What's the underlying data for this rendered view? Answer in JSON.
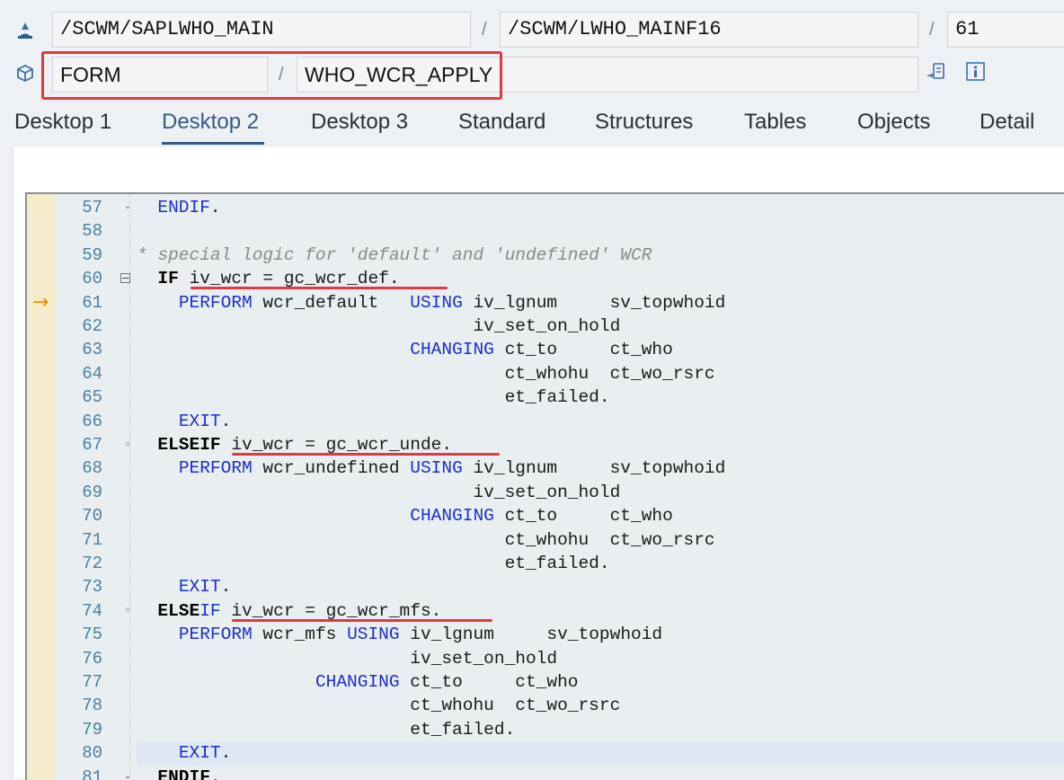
{
  "header": {
    "program": "/SCWM/SAPLWHO_MAIN",
    "include": "/SCWM/LWHO_MAINF16",
    "line": "61",
    "type": "FORM",
    "name": "WHO_WCR_APPLY",
    "sep": "/",
    "icons": [
      "program-icon",
      "cube-icon",
      "list-nav-icon",
      "info-icon"
    ]
  },
  "tabs": [
    {
      "label": "Desktop 1"
    },
    {
      "label": "Desktop 2"
    },
    {
      "label": "Desktop 3"
    },
    {
      "label": "Standard"
    },
    {
      "label": "Structures"
    },
    {
      "label": "Tables"
    },
    {
      "label": "Objects"
    },
    {
      "label": "Detail"
    }
  ],
  "active_tab": "Desktop 2",
  "current_line_marker": "→",
  "code_lines": [
    {
      "n": "57",
      "segs": [
        {
          "t": "  ",
          "c": ""
        },
        {
          "t": "ENDIF",
          "c": "kw"
        },
        {
          "t": ".",
          "c": ""
        }
      ]
    },
    {
      "n": "58",
      "segs": []
    },
    {
      "n": "59",
      "segs": [
        {
          "t": "* special logic for 'default' and 'undefined' WCR",
          "c": "cmt"
        }
      ]
    },
    {
      "n": "60",
      "segs": [
        {
          "t": "  ",
          "c": ""
        },
        {
          "t": "IF",
          "c": "kwb"
        },
        {
          "t": " iv_wcr = gc_wcr_def.",
          "c": ""
        }
      ]
    },
    {
      "n": "61",
      "segs": [
        {
          "t": "    ",
          "c": ""
        },
        {
          "t": "PERFORM",
          "c": "kw"
        },
        {
          "t": " wcr_default   ",
          "c": ""
        },
        {
          "t": "USING",
          "c": "kw"
        },
        {
          "t": " iv_lgnum     sv_topwhoid",
          "c": ""
        }
      ]
    },
    {
      "n": "62",
      "segs": [
        {
          "t": "                                iv_set_on_hold",
          "c": ""
        }
      ]
    },
    {
      "n": "63",
      "segs": [
        {
          "t": "                          ",
          "c": ""
        },
        {
          "t": "CHANGING",
          "c": "kw"
        },
        {
          "t": " ct_to     ct_who",
          "c": ""
        }
      ]
    },
    {
      "n": "64",
      "segs": [
        {
          "t": "                                   ct_whohu  ct_wo_rsrc",
          "c": ""
        }
      ]
    },
    {
      "n": "65",
      "segs": [
        {
          "t": "                                   et_failed.",
          "c": ""
        }
      ]
    },
    {
      "n": "66",
      "segs": [
        {
          "t": "    ",
          "c": ""
        },
        {
          "t": "EXIT",
          "c": "kw"
        },
        {
          "t": ".",
          "c": ""
        }
      ]
    },
    {
      "n": "67",
      "segs": [
        {
          "t": "  ",
          "c": ""
        },
        {
          "t": "ELSEIF",
          "c": "kwb"
        },
        {
          "t": " iv_wcr = gc_wcr_unde.",
          "c": ""
        }
      ]
    },
    {
      "n": "68",
      "segs": [
        {
          "t": "    ",
          "c": ""
        },
        {
          "t": "PERFORM",
          "c": "kw"
        },
        {
          "t": " wcr_undefined ",
          "c": ""
        },
        {
          "t": "USING",
          "c": "kw"
        },
        {
          "t": " iv_lgnum     sv_topwhoid",
          "c": ""
        }
      ]
    },
    {
      "n": "69",
      "segs": [
        {
          "t": "                                iv_set_on_hold",
          "c": ""
        }
      ]
    },
    {
      "n": "70",
      "segs": [
        {
          "t": "                          ",
          "c": ""
        },
        {
          "t": "CHANGING",
          "c": "kw"
        },
        {
          "t": " ct_to     ct_who",
          "c": ""
        }
      ]
    },
    {
      "n": "71",
      "segs": [
        {
          "t": "                                   ct_whohu  ct_wo_rsrc",
          "c": ""
        }
      ]
    },
    {
      "n": "72",
      "segs": [
        {
          "t": "                                   et_failed.",
          "c": ""
        }
      ]
    },
    {
      "n": "73",
      "segs": [
        {
          "t": "    ",
          "c": ""
        },
        {
          "t": "EXIT",
          "c": "kw"
        },
        {
          "t": ".",
          "c": ""
        }
      ]
    },
    {
      "n": "74",
      "segs": [
        {
          "t": "  ",
          "c": ""
        },
        {
          "t": "ELSE",
          "c": "kwb"
        },
        {
          "t": "IF",
          "c": "kw"
        },
        {
          "t": " iv_wcr = gc_wcr_mfs.",
          "c": ""
        }
      ]
    },
    {
      "n": "75",
      "segs": [
        {
          "t": "    ",
          "c": ""
        },
        {
          "t": "PERFORM",
          "c": "kw"
        },
        {
          "t": " wcr_mfs ",
          "c": ""
        },
        {
          "t": "USING",
          "c": "kw"
        },
        {
          "t": " iv_lgnum     sv_topwhoid",
          "c": ""
        }
      ]
    },
    {
      "n": "76",
      "segs": [
        {
          "t": "                          iv_set_on_hold",
          "c": ""
        }
      ]
    },
    {
      "n": "77",
      "segs": [
        {
          "t": "                 ",
          "c": ""
        },
        {
          "t": "CHANGING",
          "c": "kw"
        },
        {
          "t": " ct_to     ct_who",
          "c": ""
        }
      ]
    },
    {
      "n": "78",
      "segs": [
        {
          "t": "                          ct_whohu  ct_wo_rsrc",
          "c": ""
        }
      ]
    },
    {
      "n": "79",
      "segs": [
        {
          "t": "                          et_failed.",
          "c": ""
        }
      ]
    },
    {
      "n": "80",
      "segs": [
        {
          "t": "    ",
          "c": ""
        },
        {
          "t": "EXIT",
          "c": "kw"
        },
        {
          "t": ".",
          "c": ""
        }
      ]
    },
    {
      "n": "81",
      "segs": [
        {
          "t": "  ",
          "c": ""
        },
        {
          "t": "ENDIF",
          "c": "kwb"
        },
        {
          "t": ".",
          "c": ""
        }
      ]
    }
  ],
  "colors": {
    "accent": "#355a83",
    "highlight_box": "#e0393e",
    "keyword": "#1b2fd1",
    "line_number": "#4a7fa3",
    "gutter": "#f6eccc"
  }
}
